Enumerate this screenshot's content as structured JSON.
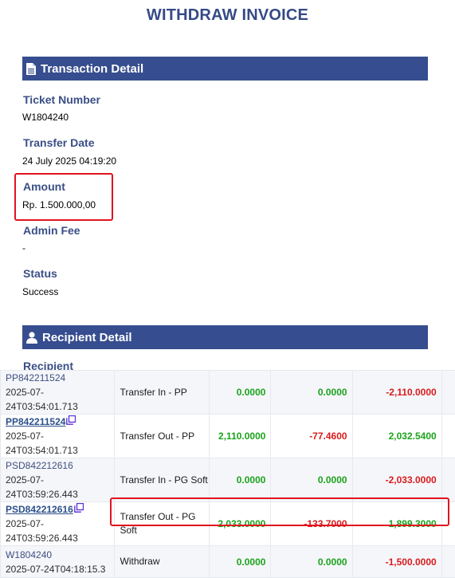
{
  "page": {
    "title": "WITHDRAW INVOICE"
  },
  "transaction_detail": {
    "header": "Transaction Detail",
    "fields": [
      {
        "label": "Ticket Number",
        "value": "W1804240"
      },
      {
        "label": "Transfer Date",
        "value": "24 July 2025 04:19:20"
      },
      {
        "label": "Amount",
        "value": "Rp. 1.500.000,00"
      },
      {
        "label": "Admin Fee",
        "value": "-"
      },
      {
        "label": "Status",
        "value": "Success"
      }
    ]
  },
  "recipient_detail": {
    "header": "Recipient Detail",
    "partial_label": "Recipient"
  },
  "colors": {
    "header_bg": "#364d8f",
    "label": "#3a4f86",
    "positive": "#1aa31a",
    "negative": "#d81b1b",
    "highlight": "#e0141e"
  },
  "transactions": [
    {
      "id": "PP842211524",
      "time": "2025-07-24T03:54:01.713",
      "type": "Transfer In - PP",
      "col1": "0.0000",
      "col2": "0.0000",
      "col3": "-2,110.0000"
    },
    {
      "id": "PP842211524",
      "time": "2025-07-24T03:54:01.713",
      "type": "Transfer Out - PP",
      "col1": "2,110.0000",
      "col2": "-77.4600",
      "col3": "2,032.5400"
    },
    {
      "id": "PSD842212616",
      "time": "2025-07-24T03:59:26.443",
      "type": "Transfer In - PG Soft",
      "col1": "0.0000",
      "col2": "0.0000",
      "col3": "-2,033.0000"
    },
    {
      "id": "PSD842212616",
      "time": "2025-07-24T03:59:26.443",
      "type": "Transfer Out - PG Soft",
      "col1": "2,033.0000",
      "col2": "-133.7000",
      "col3": "1,899.3000"
    },
    {
      "id": "W1804240",
      "time": "2025-07-24T04:18:15.3",
      "type": "Withdraw",
      "col1": "0.0000",
      "col2": "0.0000",
      "col3": "-1,500.0000"
    }
  ]
}
